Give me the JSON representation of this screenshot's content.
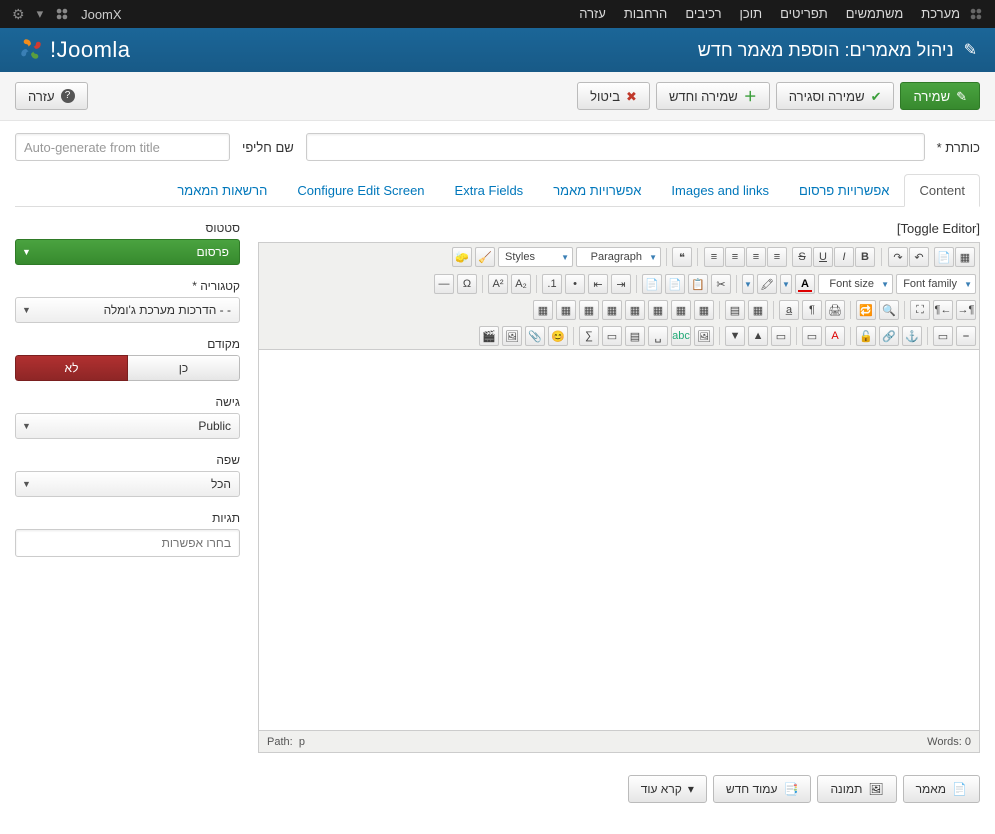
{
  "adminBar": {
    "menu": [
      "מערכת",
      "משתמשים",
      "תפריטים",
      "תוכן",
      "רכיבים",
      "הרחבות",
      "עזרה"
    ],
    "siteName": "JoomX"
  },
  "pageHeader": {
    "title": "ניהול מאמרים: הוספת מאמר חדש",
    "logoText": "Joomla!"
  },
  "toolbar": {
    "save": "שמירה",
    "saveClose": "שמירה וסגירה",
    "saveNew": "שמירה וחדש",
    "cancel": "ביטול",
    "help": "עזרה"
  },
  "form": {
    "titleLabel": "כותרת *",
    "aliasLabel": "שם חליפי",
    "aliasPlaceholder": "Auto-generate from title"
  },
  "tabs": [
    "Content",
    "אפשרויות פרסום",
    "Images and links",
    "אפשרויות מאמר",
    "Extra Fields",
    "Configure Edit Screen",
    "הרשאות המאמר"
  ],
  "sidebar": {
    "statusLabel": "סטטוס",
    "statusValue": "פרסום",
    "categoryLabel": "קטגוריה *",
    "categoryValue": "- - הדרכות מערכת ג'ומלה",
    "featuredLabel": "מקודם",
    "featuredYes": "כן",
    "featuredNo": "לא",
    "accessLabel": "גישה",
    "accessValue": "Public",
    "languageLabel": "שפה",
    "languageValue": "הכל",
    "tagsLabel": "תגיות",
    "tagsPlaceholder": "בחרו אפשרות"
  },
  "editor": {
    "toggle": "[Toggle Editor]",
    "paragraph": "Paragraph",
    "styles": "Styles",
    "fontFamily": "Font family",
    "fontSize": "Font size",
    "pathLabel": "Path:",
    "pathValue": "p",
    "wordsLabel": "Words:",
    "wordsValue": "0"
  },
  "bottomButtons": {
    "article": "מאמר",
    "image": "תמונה",
    "pagebreak": "עמוד חדש",
    "readmore": "קרא עוד"
  }
}
